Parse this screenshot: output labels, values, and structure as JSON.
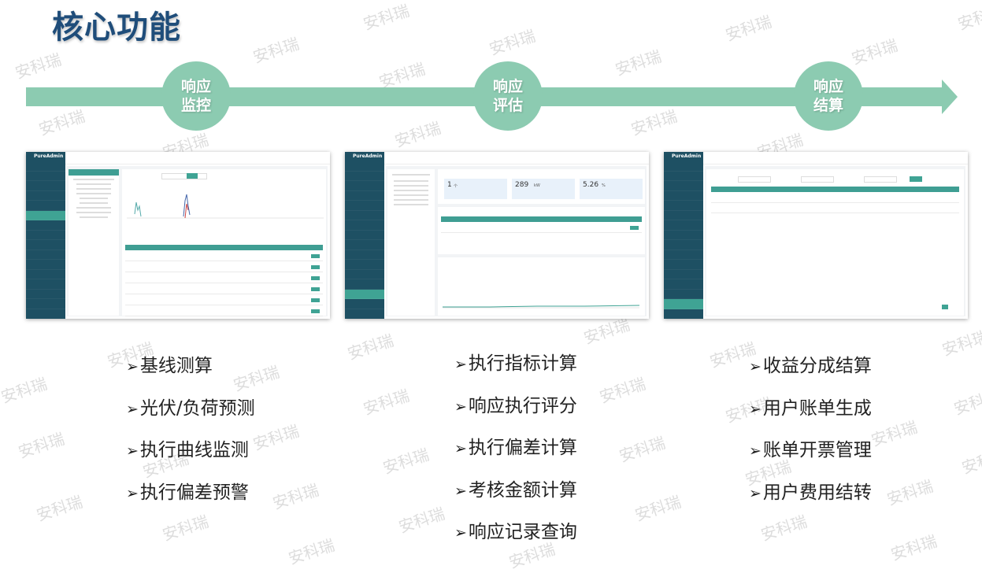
{
  "title": "核心功能",
  "watermark": "安科瑞",
  "colors": {
    "accent": "#8ccbb1",
    "title": "#1f4d7a",
    "table_header": "#3f9e93",
    "sidebar": "#1e5063"
  },
  "stages": [
    {
      "line1": "响应",
      "line2": "监控"
    },
    {
      "line1": "响应",
      "line2": "评估"
    },
    {
      "line1": "响应",
      "line2": "结算"
    }
  ],
  "screens": [
    {
      "app_name": "PureAdmin",
      "description_icon": "monitor-screenshot"
    },
    {
      "app_name": "PureAdmin",
      "kpis": [
        {
          "value": "1",
          "unit": "个"
        },
        {
          "value": "289",
          "unit": "kW"
        },
        {
          "value": "5.26",
          "unit": "%"
        }
      ]
    },
    {
      "app_name": "PureAdmin",
      "description_icon": "settlement-screenshot"
    }
  ],
  "features": {
    "col1": [
      "基线测算",
      "光伏/负荷预测",
      "执行曲线监测",
      "执行偏差预警"
    ],
    "col2": [
      "执行指标计算",
      "响应执行评分",
      "执行偏差计算",
      "考核金额计算",
      "响应记录查询"
    ],
    "col3": [
      "收益分成结算",
      "用户账单生成",
      "账单开票管理",
      "用户费用结转"
    ]
  },
  "bullet": "➢"
}
